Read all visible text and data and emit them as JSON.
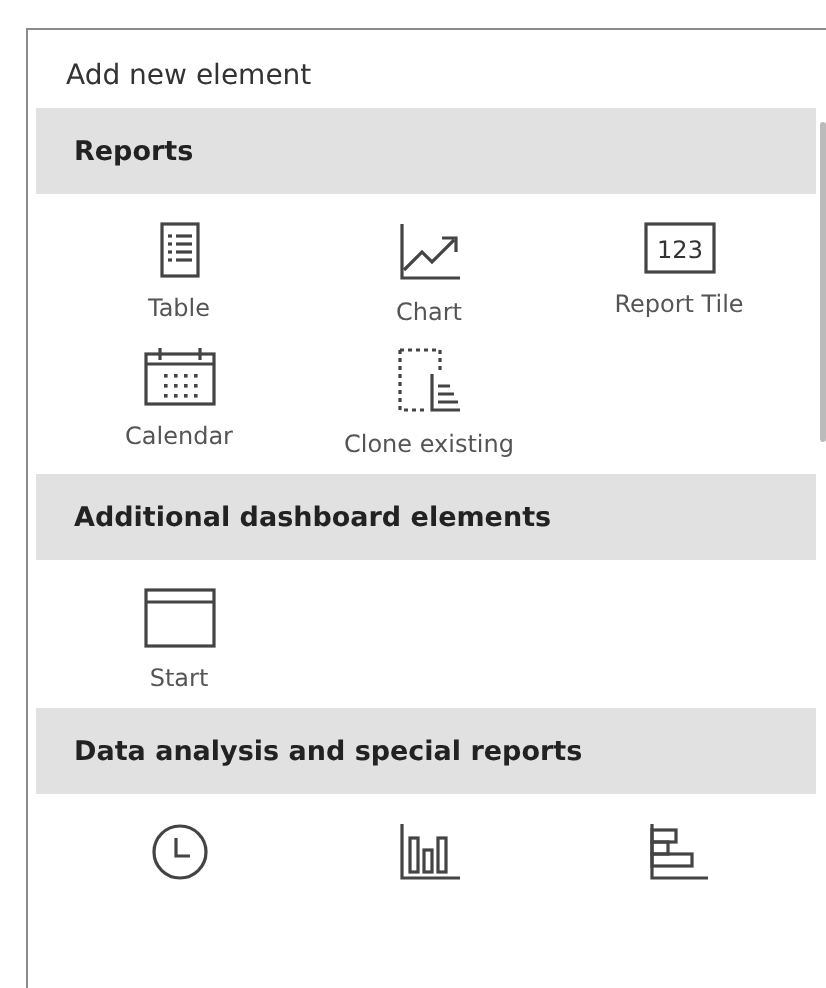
{
  "panel": {
    "title": "Add new element"
  },
  "sections": [
    {
      "title": "Reports",
      "items": [
        {
          "kind": "table",
          "label": "Table"
        },
        {
          "kind": "chart",
          "label": "Chart"
        },
        {
          "kind": "tile",
          "label": "Report Tile",
          "icon_text": "123"
        },
        {
          "kind": "calendar",
          "label": "Calendar"
        },
        {
          "kind": "clone",
          "label": "Clone existing"
        }
      ]
    },
    {
      "title": "Additional dashboard elements",
      "items": [
        {
          "kind": "window",
          "label": "Start"
        }
      ]
    },
    {
      "title": "Data analysis and special reports",
      "items": [
        {
          "kind": "clock"
        },
        {
          "kind": "bars"
        },
        {
          "kind": "hbars"
        }
      ]
    }
  ]
}
